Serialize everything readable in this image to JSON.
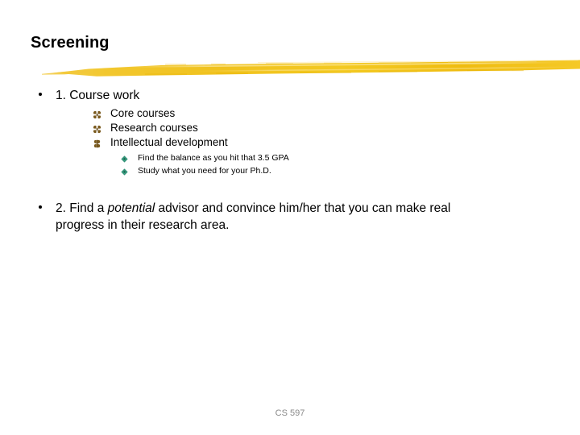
{
  "slide": {
    "title": "Screening",
    "accent_color": "#F0C21E",
    "background_color": "#FFFFFF",
    "footer": "CS 597"
  },
  "bullets": {
    "level1": [
      {
        "text": "1. Course work"
      },
      {
        "text_before_italic": "2. Find a ",
        "italic": "potential",
        "text_after_italic": " advisor and convince him/her that you can make real progress in their research area."
      }
    ],
    "level2": [
      {
        "label": "Core courses",
        "bullet_icon": "flower-bullet-icon",
        "bullet_color": "#7A5A1E"
      },
      {
        "label": "Research courses",
        "bullet_icon": "flower-bullet-icon",
        "bullet_color": "#7A5A1E"
      },
      {
        "label": "Intellectual development",
        "bullet_icon": "flower-bullet-icon",
        "bullet_color": "#7A5A1E"
      }
    ],
    "level3": [
      {
        "label": "Find the balance as you hit that 3.5 GPA",
        "bullet_icon": "gem-bullet-icon",
        "bullet_color": "#2E8C72"
      },
      {
        "label": "Study what you need for your Ph.D.",
        "bullet_icon": "gem-bullet-icon",
        "bullet_color": "#2E8C72"
      }
    ]
  }
}
